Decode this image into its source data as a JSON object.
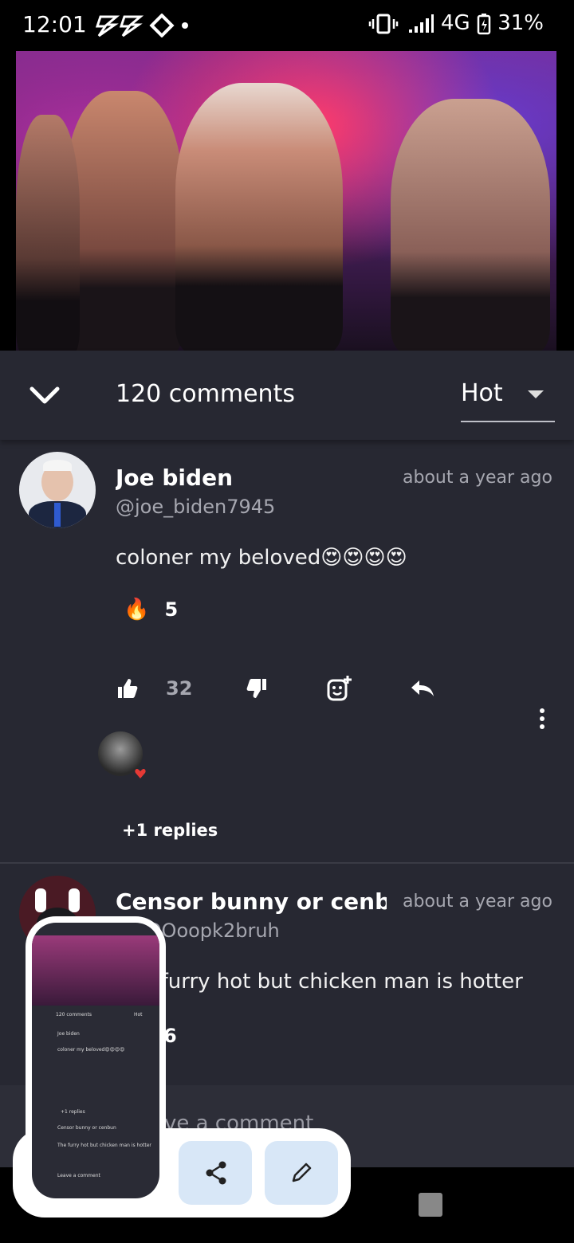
{
  "status_bar": {
    "time": "12:01",
    "battery": "31%",
    "network": "4G"
  },
  "comments_header": {
    "count_label": "120 comments",
    "sort_label": "Hot"
  },
  "comments": [
    {
      "author": "Joe biden",
      "handle": "@joe_biden7945",
      "time": "about a year ago",
      "text": "coloner my beloved😍😍😍😍",
      "reaction_emoji": "🔥",
      "reaction_count": "5",
      "likes": "32",
      "replies_label": "+1 replies"
    },
    {
      "author": "Censor bunny or cenbun",
      "handle": "@TOOoopk2bruh",
      "time": "about a year ago",
      "text": "The furry hot but chicken man is hotter",
      "reaction_count": "6"
    }
  ],
  "composer": {
    "placeholder": "Leave a comment"
  },
  "colors": {
    "panel": "#272832",
    "fab": "#d8e7f7",
    "accent_heart": "#e53935"
  }
}
